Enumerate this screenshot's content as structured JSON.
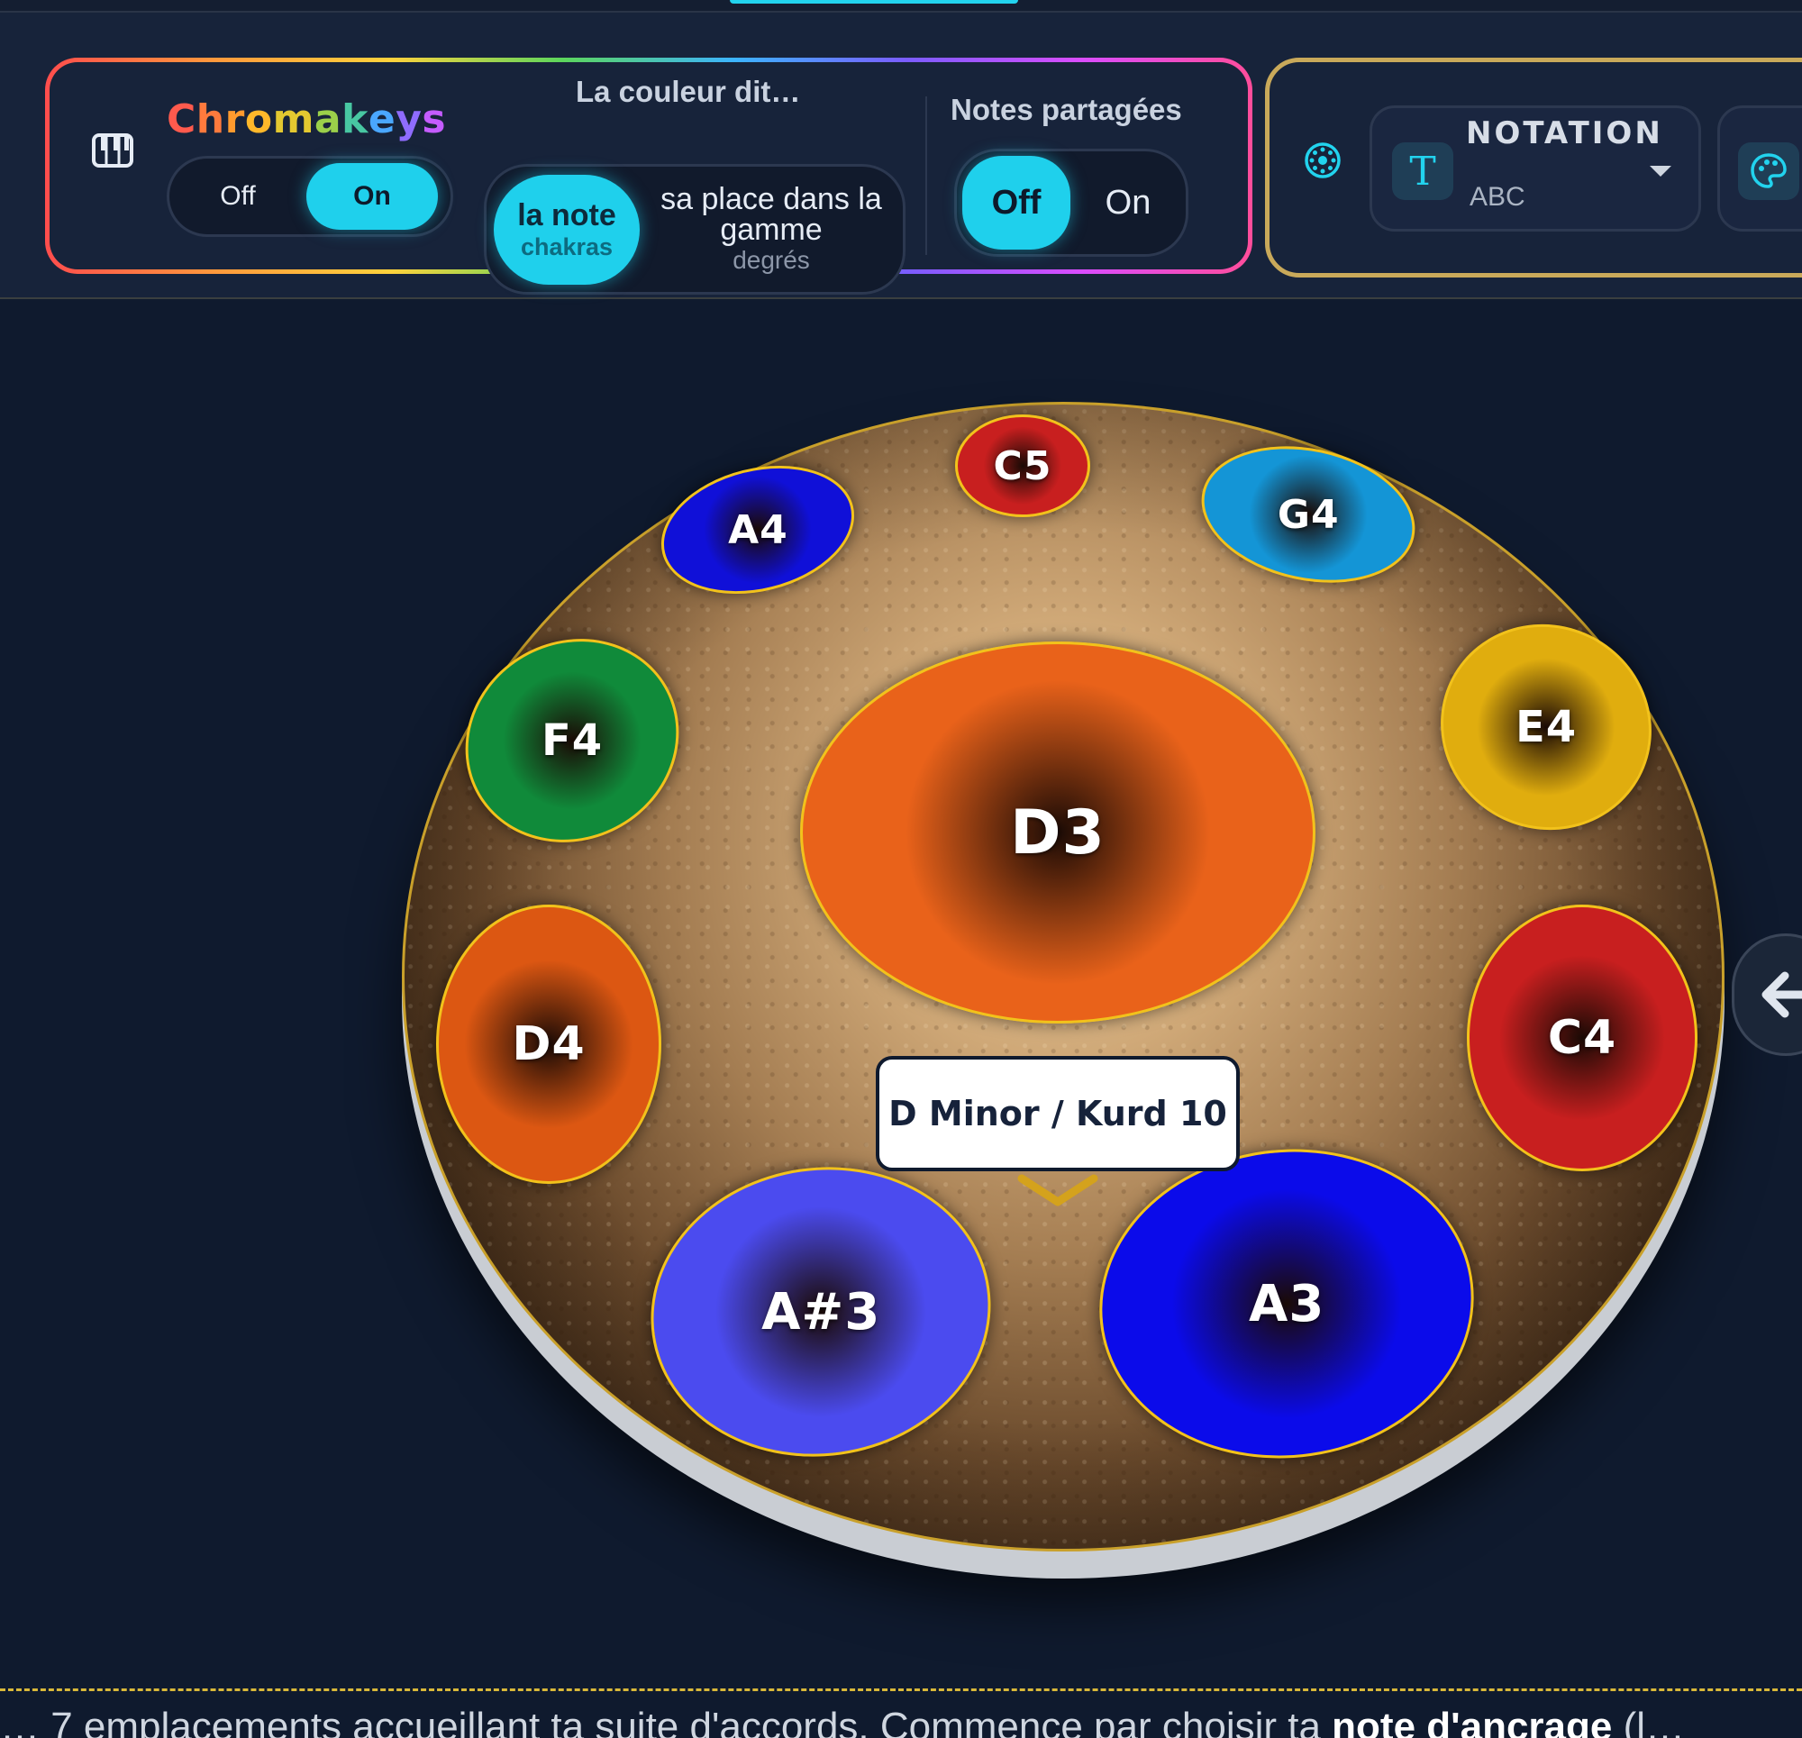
{
  "chromakeys": {
    "brand": [
      "C",
      "h",
      "r",
      "o",
      "m",
      "a",
      "k",
      "e",
      "y",
      "s"
    ],
    "brand_colors": [
      "#ff5a4d",
      "#ff7a3d",
      "#ff9a2e",
      "#ffb82a",
      "#e3c830",
      "#9bd04a",
      "#48c7a2",
      "#4aa7ff",
      "#8f6cff",
      "#c45cff"
    ],
    "off_label": "Off",
    "on_label": "On",
    "state": "On"
  },
  "color_source": {
    "title": "La couleur dit…",
    "option_note": "la note",
    "option_note_sub": "chakras",
    "option_gamme": "sa place dans la gamme",
    "option_gamme_sub": "degrés",
    "selected": "la note"
  },
  "shared_notes": {
    "title": "Notes partagées",
    "off_label": "Off",
    "on_label": "On",
    "state": "Off"
  },
  "notation": {
    "title": "NOTATION",
    "value": "ABC"
  },
  "icons": {
    "piano": "piano-icon",
    "handpan": "handpan-icon",
    "notation": "text-T-icon",
    "palette": "palette-icon",
    "back": "arrow-left-icon",
    "chevron": "chevron-down-icon"
  },
  "accent_color": "#1fd0ec",
  "handpan": {
    "scale": "D Minor / Kurd 10",
    "notes": [
      {
        "id": "d3",
        "label": "D3",
        "color": "#e9621a"
      },
      {
        "id": "c5",
        "label": "C5",
        "color": "#c81f1f"
      },
      {
        "id": "a4",
        "label": "A4",
        "color": "#1010d8"
      },
      {
        "id": "g4",
        "label": "G4",
        "color": "#1495d6"
      },
      {
        "id": "f4",
        "label": "F4",
        "color": "#108a3a"
      },
      {
        "id": "e4",
        "label": "E4",
        "color": "#e0ad0e"
      },
      {
        "id": "d4",
        "label": "D4",
        "color": "#dc5712"
      },
      {
        "id": "c4",
        "label": "C4",
        "color": "#c81f1f"
      },
      {
        "id": "a_sharp3",
        "label": "A#3",
        "color": "#4b4bef"
      },
      {
        "id": "a3",
        "label": "A3",
        "color": "#0b0bea"
      }
    ]
  },
  "footer": {
    "text_start": "… 7 emplacements accueillant ta suite d'accords. Commence par choisir ta ",
    "text_bold": "note d'ancrage",
    "text_end": " (l…"
  }
}
